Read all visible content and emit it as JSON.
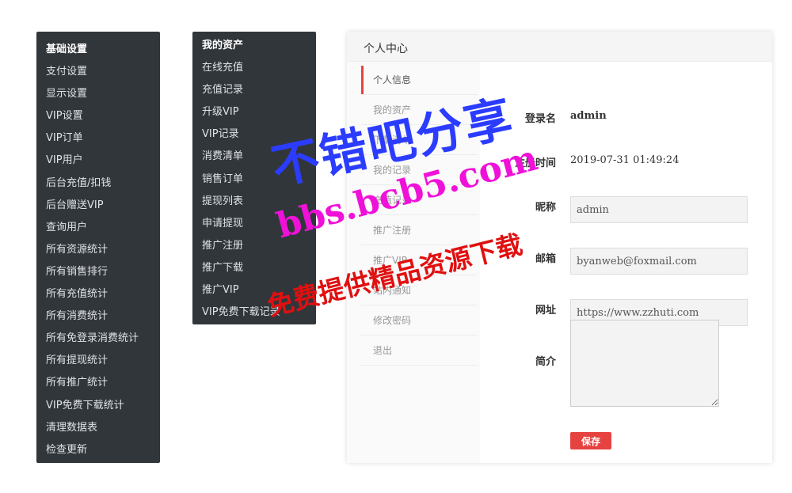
{
  "menu1": {
    "items": [
      "基础设置",
      "支付设置",
      "显示设置",
      "VIP设置",
      "VIP订单",
      "VIP用户",
      "后台充值/扣钱",
      "后台赠送VIP",
      "查询用户",
      "所有资源统计",
      "所有销售排行",
      "所有充值统计",
      "所有消费统计",
      "所有免登录消费统计",
      "所有提现统计",
      "所有推广统计",
      "VIP免费下载统计",
      "清理数据表",
      "检查更新"
    ]
  },
  "menu2": {
    "items": [
      "我的资产",
      "在线充值",
      "充值记录",
      "升级VIP",
      "VIP记录",
      "消费清单",
      "销售订单",
      "提现列表",
      "申请提现",
      "推广注册",
      "推广下载",
      "推广VIP",
      "VIP免费下载记录"
    ]
  },
  "panel": {
    "title": "个人中心",
    "nav": [
      "个人信息",
      "我的资产",
      "下载清单",
      "我的记录",
      "充值记录",
      "推广注册",
      "推广VIP",
      "站内通知",
      "修改密码",
      "退出"
    ],
    "form": {
      "username_label": "登录名",
      "username": "admin",
      "regtime_label": "注册时间",
      "regtime": "2019-07-31 01:49:24",
      "nickname_label": "昵称",
      "nickname": "admin",
      "email_label": "邮箱",
      "email": "byanweb@foxmail.com",
      "website_label": "网址",
      "website": "https://www.zzhuti.com",
      "bio_label": "简介",
      "save_label": "保存"
    }
  },
  "watermark": {
    "line1": "不错吧分享",
    "line2": "bbs.bcb5.com",
    "line3": "免费提供精品资源下载"
  },
  "colors": {
    "menu_bg": "#31363b",
    "accent": "#e64340"
  }
}
